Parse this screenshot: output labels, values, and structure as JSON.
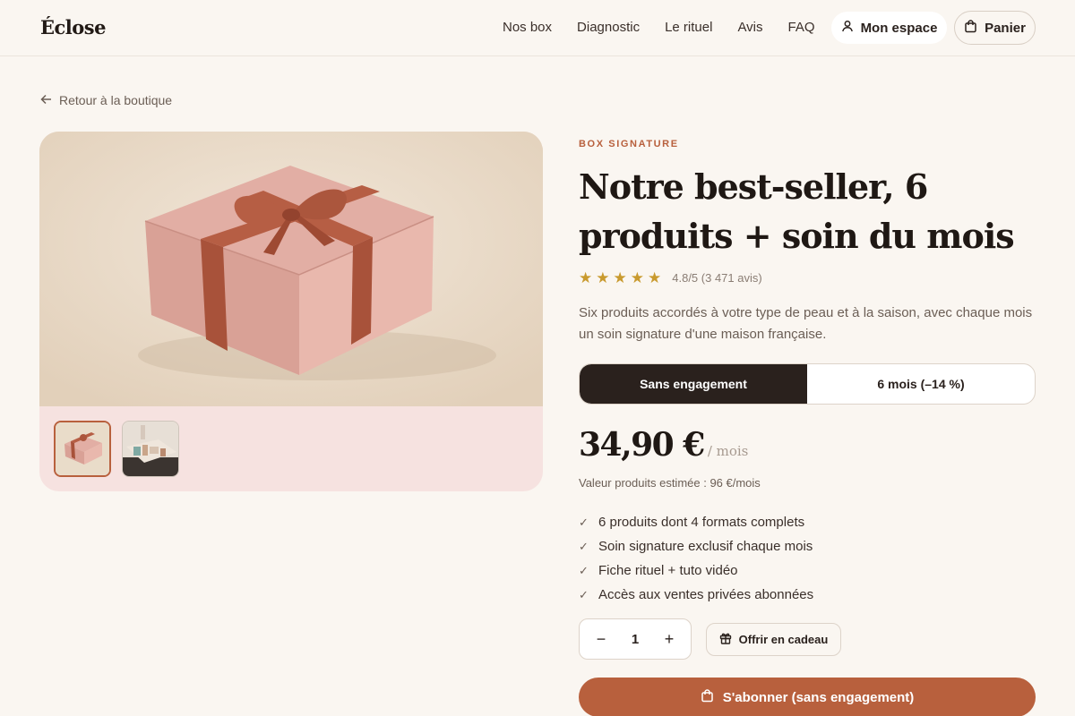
{
  "brand": {
    "logo": "Éclose"
  },
  "nav": {
    "items": [
      "Nos box",
      "Diagnostic",
      "Le rituel",
      "Avis",
      "FAQ"
    ],
    "account_label": "Mon espace",
    "cart_label": "Panier"
  },
  "breadcrumb": {
    "back_label": "Retour à la boutique"
  },
  "product": {
    "eyebrow": "BOX SIGNATURE",
    "title": "Notre best-seller, 6 produits + soin du mois",
    "rating": {
      "stars": 5,
      "text": "4.8/5 (3 471 avis)"
    },
    "description": "Six produits accordés à votre type de peau et à la saison, avec chaque mois un soin signature d'une maison française.",
    "plans": [
      {
        "label": "Sans engagement",
        "selected": true
      },
      {
        "label": "6 mois (–14 %)",
        "selected": false
      }
    ],
    "price": "34,90 €",
    "price_unit": "/ mois",
    "value_note": "Valeur produits estimée : 96 €/mois",
    "features": [
      "6 produits dont 4 formats complets",
      "Soin signature exclusif chaque mois",
      "Fiche rituel + tuto vidéo",
      "Accès aux ventes privées abonnées"
    ],
    "quantity": "1",
    "qty_minus": "−",
    "qty_plus": "+",
    "gift_label": "Offrir en cadeau",
    "cta_label": "S'abonner (sans engagement)"
  },
  "gallery": {
    "thumbnails": [
      "gift-box",
      "box-contents"
    ],
    "active_index": 0
  },
  "colors": {
    "accent": "#b8603d",
    "dark": "#2a211d",
    "background": "#faf6f1",
    "star": "#c99a2e"
  }
}
